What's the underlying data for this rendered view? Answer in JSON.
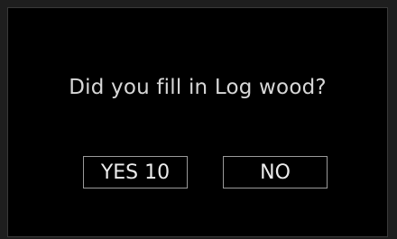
{
  "dialog": {
    "question": "Did you fill in Log wood?",
    "yes_label": "YES 10",
    "no_label": "NO"
  }
}
